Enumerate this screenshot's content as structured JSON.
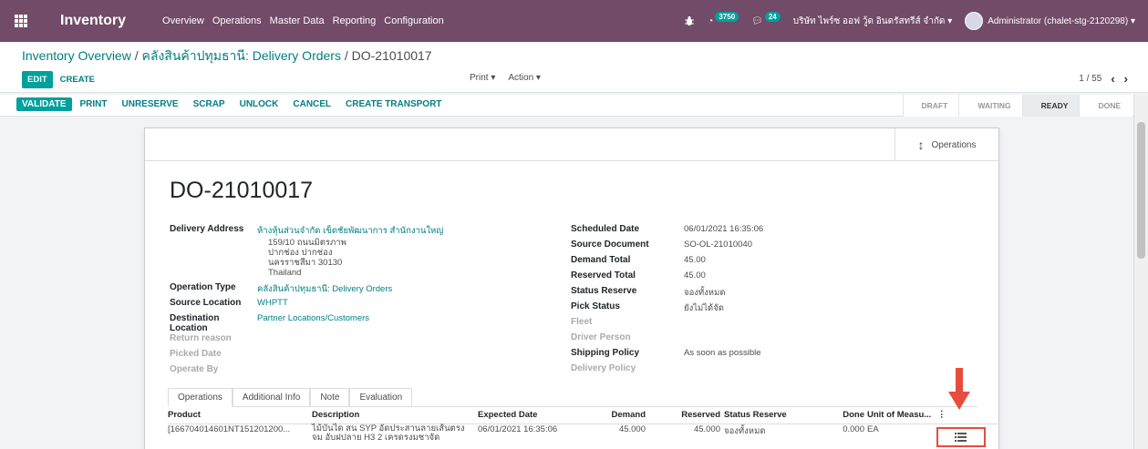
{
  "navbar": {
    "app_name": "Inventory",
    "menu": [
      "Overview",
      "Operations",
      "Master Data",
      "Reporting",
      "Configuration"
    ],
    "activity_count": "3750",
    "message_count": "24",
    "company": "บริษัท ไพร์ซ ออฟ วู้ด อินดรัสทรีส์ จำกัด ▾",
    "user": "Administrator (chalet-stg-2120298) ▾"
  },
  "breadcrumb": {
    "part1": "Inventory Overview",
    "part2": "คลังสินค้าปทุมธานี: Delivery Orders",
    "current": "DO-21010017"
  },
  "control": {
    "edit": "EDIT",
    "create": "CREATE",
    "print": "Print ▾",
    "action": "Action ▾",
    "pager": "1 / 55"
  },
  "statusbar": {
    "buttons": [
      "VALIDATE",
      "PRINT",
      "UNRESERVE",
      "SCRAP",
      "UNLOCK",
      "CANCEL",
      "CREATE TRANSPORT"
    ],
    "stages": [
      "DRAFT",
      "WAITING",
      "READY",
      "DONE"
    ],
    "active_stage": "READY"
  },
  "sheet": {
    "operations_button": "Operations",
    "title": "DO-21010017",
    "left_fields": {
      "delivery_address_label": "Delivery Address",
      "delivery_address_name": "ห้างหุ้นส่วนจำกัด เข็ดชัยพัฒนาการ สำนักงานใหญ่",
      "address_lines": [
        "159/10 ถนนมิตรภาพ",
        "ปากช่อง ปากช่อง",
        "นครราชสีมา 30130",
        "Thailand"
      ],
      "operation_type_label": "Operation Type",
      "operation_type": "คลังสินค้าปทุมธานี: Delivery Orders",
      "source_location_label": "Source Location",
      "source_location": "WHPTT",
      "destination_location_label": "Destination Location",
      "destination_location": "Partner Locations/Customers",
      "return_reason_label": "Return reason",
      "picked_date_label": "Picked Date",
      "operate_by_label": "Operate By"
    },
    "right_fields": {
      "scheduled_date_label": "Scheduled Date",
      "scheduled_date": "06/01/2021 16:35:06",
      "source_document_label": "Source Document",
      "source_document": "SO-OL-21010040",
      "demand_total_label": "Demand Total",
      "demand_total": "45.00",
      "reserved_total_label": "Reserved Total",
      "reserved_total": "45.00",
      "status_reserve_label": "Status Reserve",
      "status_reserve": "จองทั้งหมด",
      "pick_status_label": "Pick Status",
      "pick_status": "ยังไม่ได้จัด",
      "fleet_label": "Fleet",
      "driver_person_label": "Driver Person",
      "shipping_policy_label": "Shipping Policy",
      "shipping_policy": "As soon as possible",
      "delivery_policy_label": "Delivery Policy"
    },
    "tabs": [
      "Operations",
      "Additional Info",
      "Note",
      "Evaluation"
    ],
    "table": {
      "headers": [
        "Product",
        "Description",
        "Expected Date",
        "Demand",
        "Reserved",
        "Status Reserve",
        "Done",
        "Unit of Measu...",
        "⋮"
      ],
      "row": {
        "product": "[166704014601NT151201200...",
        "description_line1": "ไม้บันได สน SYP อัดประสานลายเส้นตรง",
        "description_line2": "จม อับฝปลาย H3 2 เครดรงมชาจัด",
        "expected_date": "06/01/2021 16:35:06",
        "demand": "45.000",
        "reserved": "45.000",
        "status_reserve": "จองทั้งหมด",
        "done": "0.000",
        "uom": "EA"
      }
    }
  },
  "colors": {
    "navbar": "#714b67",
    "primary": "#00a09d",
    "link": "#017e84",
    "annotation": "#e74c3c"
  }
}
